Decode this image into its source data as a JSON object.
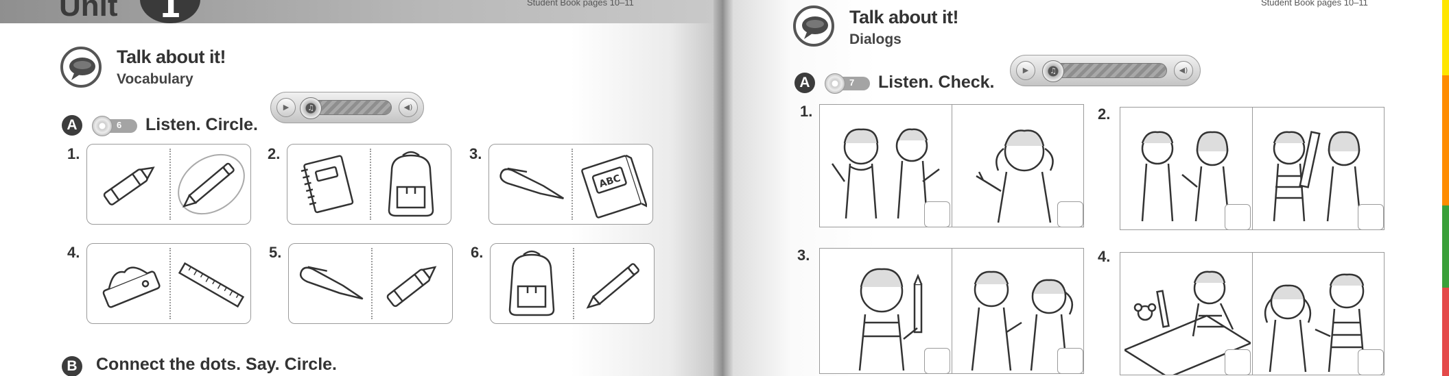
{
  "left_page": {
    "unit_label": "Unit",
    "unit_number": "1",
    "student_book_pages": "Student Book pages 10–11",
    "section_title": "Talk about it!",
    "section_subtitle": "Vocabulary",
    "activity_a": {
      "letter": "A",
      "track": "6",
      "instruction": "Listen. Circle."
    },
    "items": [
      {
        "number": "1.",
        "icons": [
          "crayon-icon",
          "pencil-icon"
        ]
      },
      {
        "number": "2.",
        "icons": [
          "notebook-icon",
          "backpack-icon"
        ]
      },
      {
        "number": "3.",
        "icons": [
          "pen-icon",
          "book-icon"
        ],
        "book_text": "ABC"
      },
      {
        "number": "4.",
        "icons": [
          "eraser-icon",
          "ruler-icon"
        ]
      },
      {
        "number": "5.",
        "icons": [
          "pen-icon",
          "crayon-icon"
        ]
      },
      {
        "number": "6.",
        "icons": [
          "backpack-icon",
          "pencil-icon"
        ]
      }
    ],
    "activity_b": {
      "letter": "B",
      "instruction": "Connect the dots. Say. Circle."
    }
  },
  "right_page": {
    "student_book_pages": "Student Book pages 10–11",
    "section_title": "Talk about it!",
    "section_subtitle": "Dialogs",
    "activity_a": {
      "letter": "A",
      "track": "7",
      "instruction": "Listen. Check."
    },
    "items": [
      {
        "number": "1."
      },
      {
        "number": "2."
      },
      {
        "number": "3."
      },
      {
        "number": "4."
      }
    ]
  },
  "colors": {
    "edge_left": [
      "#e6007e",
      "#9ad400",
      "#00a0a0",
      "#00a0e0"
    ],
    "edge_right": [
      "#ffe600",
      "#ff7f00",
      "#3aa03a",
      "#e44a4a"
    ]
  }
}
